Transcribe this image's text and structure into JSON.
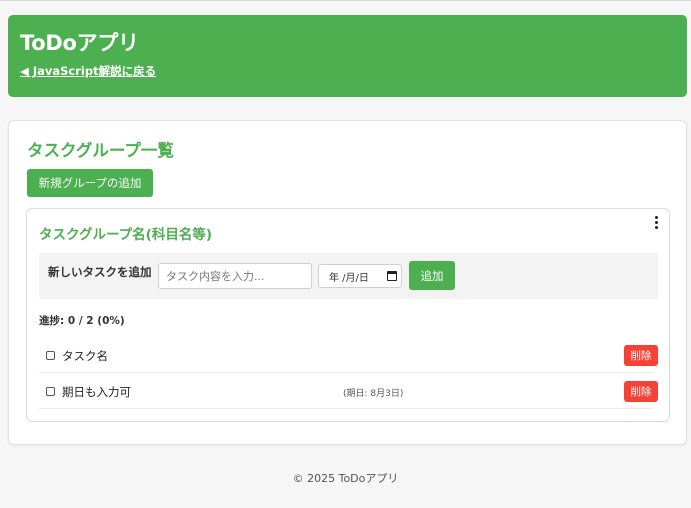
{
  "header": {
    "title": "ToDoアプリ",
    "back_link": "◀ JavaScript解説に戻る"
  },
  "main": {
    "title": "タスクグループ一覧",
    "add_group_label": "新規グループの追加",
    "group": {
      "title": "タスクグループ名(科目名等)",
      "menu_icon": "kebab-icon",
      "add_task_label": "新しいタスクを追加",
      "task_placeholder": "タスク内容を入力...",
      "date_placeholder": "年 /月/日",
      "date_icon": "calendar-icon",
      "add_button": "追加",
      "progress": "進捗: 0 / 2 (0%)",
      "tasks": [
        {
          "name": "タスク名",
          "due": "",
          "completed": false,
          "delete_label": "削除"
        },
        {
          "name": "期日も入力可",
          "due": "(期日: 8月3日)",
          "completed": false,
          "delete_label": "削除"
        }
      ]
    }
  },
  "footer": {
    "text": "© 2025 ToDoアプリ"
  },
  "colors": {
    "primary": "#4caf50",
    "danger": "#f44336",
    "background": "#f6f6f6"
  }
}
